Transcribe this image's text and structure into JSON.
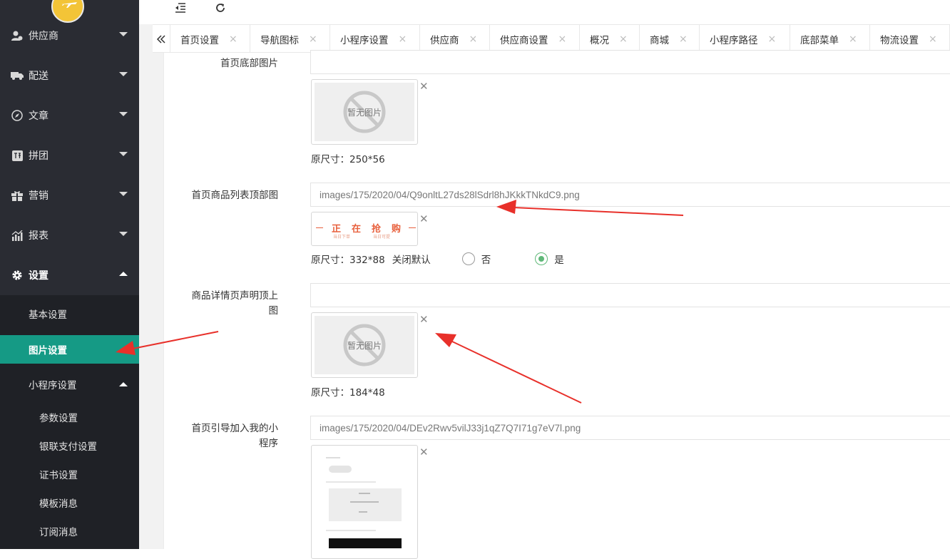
{
  "colors": {
    "sidebar_bg": "#2a2c33",
    "submenu_bg": "#1f2126",
    "accent": "#159a85",
    "radio_on": "#5fb878",
    "arrow": "#e8302a"
  },
  "sidebar": {
    "items": [
      {
        "label": "供应商",
        "icon": "supplier-icon"
      },
      {
        "label": "配送",
        "icon": "truck-icon"
      },
      {
        "label": "文章",
        "icon": "compass-icon"
      },
      {
        "label": "拼团",
        "icon": "group-buy-icon"
      },
      {
        "label": "营销",
        "icon": "gift-icon"
      },
      {
        "label": "报表",
        "icon": "chart-icon"
      },
      {
        "label": "设置",
        "icon": "gear-icon"
      }
    ],
    "sub": {
      "basic": "基本设置",
      "image": "图片设置",
      "mini": "小程序设置",
      "params": "参数设置",
      "unionpay": "银联支付设置",
      "cert": "证书设置",
      "template": "模板消息",
      "subscribe": "订阅消息"
    }
  },
  "tabs": [
    "首页设置",
    "导航图标",
    "小程序设置",
    "供应商",
    "供应商设置",
    "概况",
    "商城",
    "小程序路径",
    "底部菜单",
    "物流设置"
  ],
  "form": {
    "f1": {
      "label": "首页底部图片",
      "value": "",
      "noimg": "暂无图片",
      "size": "原尺寸：250*56"
    },
    "f2": {
      "label": "首页商品列表顶部图",
      "value": "images/175/2020/04/Q9onltL27ds28lSdrl8hJKkkTNkdC9.png",
      "size": "原尺寸：332*88",
      "close_default": "关闭默认",
      "opt_no": "否",
      "opt_yes": "是",
      "banner": {
        "c1": "正",
        "c2": "在",
        "c3": "抢",
        "c4": "购",
        "sub1": "当日下单",
        "sub2": "当日可提"
      }
    },
    "f3": {
      "label_l1": "商品详情页声明顶上",
      "label_l2": "图",
      "value": "",
      "noimg": "暂无图片",
      "size": "原尺寸：184*48"
    },
    "f4": {
      "label_l1": "首页引导加入我的小",
      "label_l2": "程序",
      "value": "images/175/2020/04/DEv2Rwv5vilJ33j1qZ7Q7I71g7eV7l.png"
    }
  }
}
